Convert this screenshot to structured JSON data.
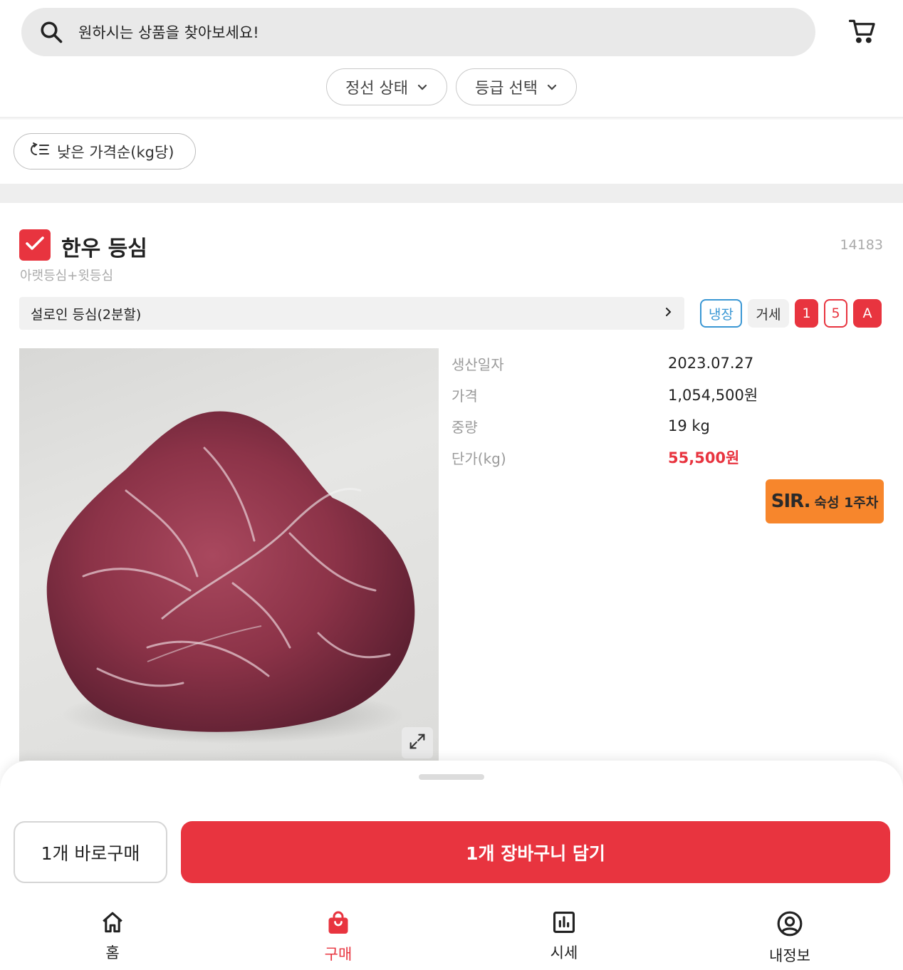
{
  "header": {
    "search_placeholder": "원하시는 상품을 찾아보세요!",
    "filters": [
      "정선 상태",
      "등급 선택"
    ]
  },
  "sort": {
    "label": "낮은 가격순(kg당)"
  },
  "product": {
    "title": "한우 등심",
    "id": "14183",
    "subtitle": "아랫등심+윗등심",
    "cut": "설로인 등심(2분할)",
    "tags": {
      "storage": "냉장",
      "carcass": "거세",
      "grade1": "1",
      "grade2": "5",
      "grade3": "A"
    },
    "specs": [
      {
        "label": "생산일자",
        "value": "2023.07.27"
      },
      {
        "label": "가격",
        "value": "1,054,500원"
      },
      {
        "label": "중량",
        "value": "19 kg"
      },
      {
        "label": "단가(kg)",
        "value": "55,500원"
      }
    ],
    "badge": {
      "logo": "SIR.",
      "text": "숙성 1주차"
    }
  },
  "actions": {
    "buy_now": "1개 바로구매",
    "add_cart": "1개 장바구니 담기"
  },
  "nav": [
    {
      "label": "홈",
      "icon": "home-icon"
    },
    {
      "label": "구매",
      "icon": "shopping-bag-icon",
      "active": true
    },
    {
      "label": "시세",
      "icon": "bar-chart-icon"
    },
    {
      "label": "내정보",
      "icon": "user-circle-icon"
    }
  ],
  "colors": {
    "accent": "#e8343f",
    "badge": "#f7862c",
    "storage_tag": "#3a97d4"
  }
}
